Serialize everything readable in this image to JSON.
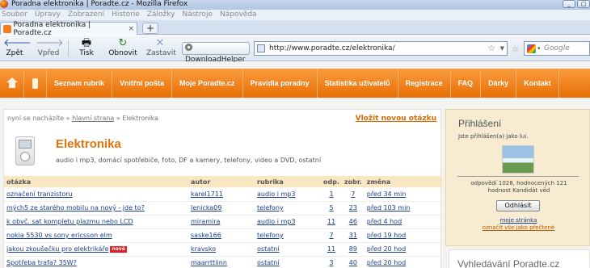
{
  "window": {
    "title": "Poradna elektronika | Poradte.cz - Mozilla Firefox",
    "buttons": [
      "_",
      "▢"
    ]
  },
  "menu": [
    "Soubor",
    "Úpravy",
    "Zobrazení",
    "Historie",
    "Záložky",
    "Nástroje",
    "Nápověda"
  ],
  "tab": {
    "label": "Poradna elektronika | Poradte.cz",
    "close": "×",
    "new_tab": "+"
  },
  "toolbar": {
    "back": "Zpět",
    "forward": "Vpřed",
    "print": "Tisk",
    "reload": "Obnovit",
    "stop": "Zastavit",
    "download_helper": "DownloadHelper",
    "url": "http://www.poradte.cz/elektronika/",
    "search_placeholder": "Google"
  },
  "site_nav": [
    "Seznam rubrik",
    "Vnitřní pošta",
    "Moje Poradte.cz",
    "Pravidla poradny",
    "Statistika uživatelů",
    "Registrace",
    "FAQ",
    "Dárky",
    "Kontakt"
  ],
  "breadcrumb": {
    "prefix": "nyní se nacházíte »",
    "home": "hlavní strana",
    "sep": "»",
    "current": "Elektronika"
  },
  "new_question": "Vložit novou otázku",
  "category": {
    "title": "Elektronika",
    "description": "audio i mp3, domácí spotřebiče, foto, DF a kamery, telefony, video a DVD, ostatní"
  },
  "table": {
    "headers": [
      "otázka",
      "autor",
      "rubrika",
      "odp.",
      "zobr.",
      "změna"
    ],
    "rows": [
      {
        "q": "označení tranzistoru",
        "badge": "",
        "author": "karel1711",
        "rubric": "audio i mp3",
        "answers": "1",
        "views": "7",
        "changed": "před 34 min"
      },
      {
        "q": "mých5 ze starého mobilu na nový - jde to?",
        "badge": "",
        "author": "lenicka09",
        "rubric": "telefony",
        "answers": "5",
        "views": "23",
        "changed": "před 103 min"
      },
      {
        "q": "k obvč. sat kompletu plazmu nebo LCD",
        "badge": "",
        "author": "miramira",
        "rubric": "audio i mp3",
        "answers": "11",
        "views": "46",
        "changed": "před 4 hod"
      },
      {
        "q": "nokia 5530 vs sony ericsson elm",
        "badge": "",
        "author": "saske166",
        "rubric": "telefony",
        "answers": "7",
        "views": "31",
        "changed": "před 19 hod"
      },
      {
        "q": "jakou zkoušečku pro elektrikáře",
        "badge": "nové",
        "author": "kravsko",
        "rubric": "ostatní",
        "answers": "11",
        "views": "89",
        "changed": "před 20 hod"
      },
      {
        "q": "Spotřeba trafa? 35W?",
        "badge": "",
        "author": "maarrttiinn",
        "rubric": "ostatní",
        "answers": "3",
        "views": "40",
        "changed": "před 20 hod"
      }
    ]
  },
  "login_box": {
    "title": "Přihlášení",
    "status": "Jste přihlášen(a) jako lui.",
    "stats_line1": "odpovědí 1028, hodnocených 121",
    "stats_line2": "hodnost Kandidát věd",
    "logout": "Odhlásit",
    "my_page": "moje stránka",
    "mark_read": "označit vše jako přečtené"
  },
  "search_box_title": "Vyhledávání Poradte.cz"
}
